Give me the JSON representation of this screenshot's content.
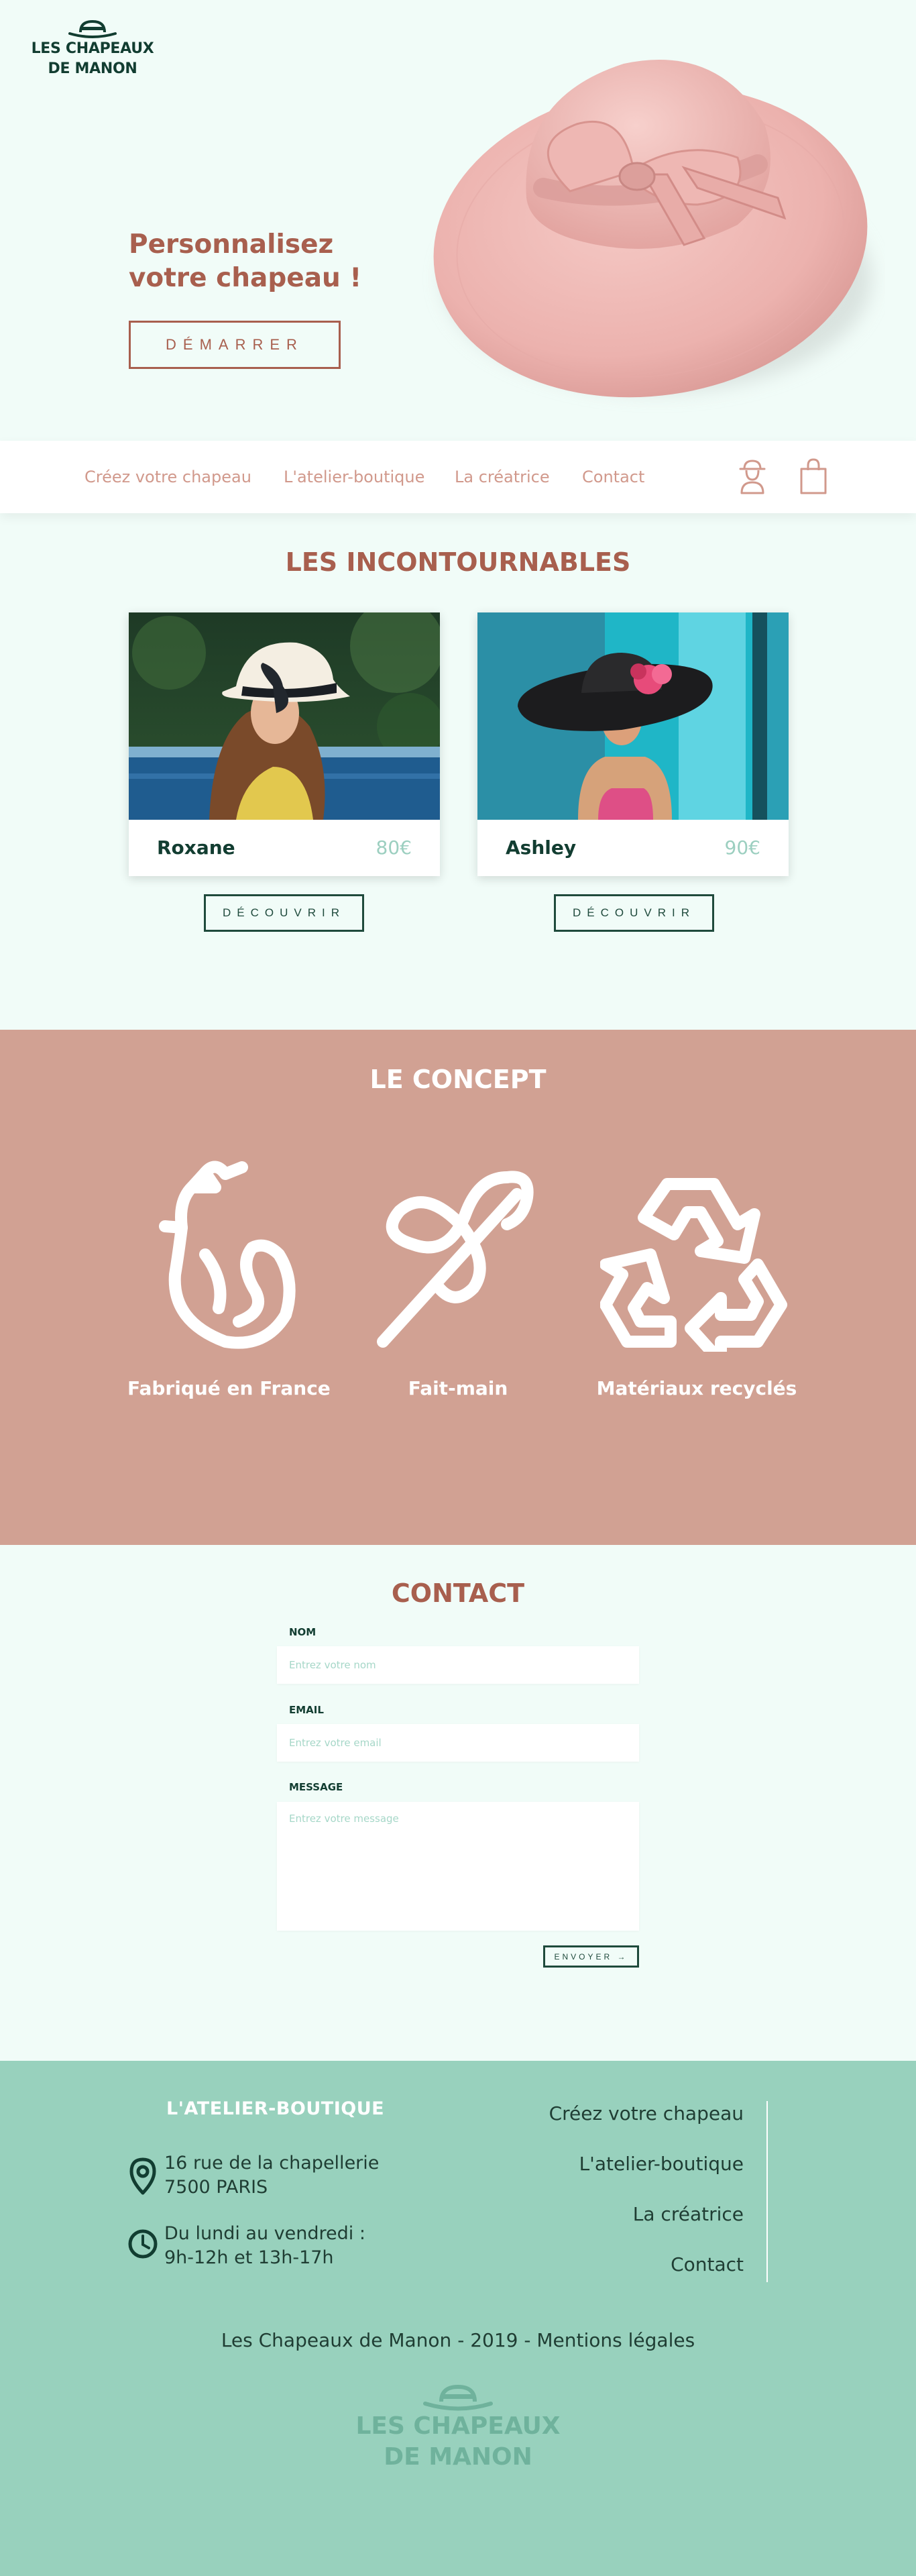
{
  "brand": {
    "line1": "LES CHAPEAUX",
    "line2": "DE MANON"
  },
  "hero": {
    "title": "Personnalisez votre chapeau !",
    "cta": "DÉMARRER"
  },
  "nav": {
    "links": [
      "Créez votre chapeau",
      "L'atelier-boutique",
      "La créatrice",
      "Contact"
    ],
    "icons": [
      "user-icon",
      "shopping-bag-icon"
    ]
  },
  "incontournables": {
    "title": "LES INCONTOURNABLES",
    "products": [
      {
        "name": "Roxane",
        "price": "80€",
        "button": "DÉCOUVRIR"
      },
      {
        "name": "Ashley",
        "price": "90€",
        "button": "DÉCOUVRIR"
      }
    ]
  },
  "concept": {
    "title": "LE CONCEPT",
    "items": [
      {
        "label": "Fabriqué en France",
        "icon": "rooster-icon"
      },
      {
        "label": "Fait-main",
        "icon": "needle-thread-icon"
      },
      {
        "label": "Matériaux recyclés",
        "icon": "recycle-icon"
      }
    ]
  },
  "contact": {
    "title": "CONTACT",
    "name_label": "NOM",
    "name_placeholder": "Entrez votre nom",
    "email_label": "EMAIL",
    "email_placeholder": "Entrez votre email",
    "message_label": "MESSAGE",
    "message_placeholder": "Entrez votre message",
    "send": "ENVOYER →"
  },
  "footer": {
    "heading": "L'ATELIER-BOUTIQUE",
    "address_line1": "16 rue de la chapellerie",
    "address_line2": "7500 PARIS",
    "hours_line1": "Du lundi au vendredi :",
    "hours_line2": "9h-12h et 13h-17h",
    "links": [
      "Créez votre chapeau",
      "L'atelier-boutique",
      "La créatrice",
      "Contact"
    ],
    "legal_prefix": "Les Chapeaux de Manon - 2019 - ",
    "legal_link": "Mentions légales"
  },
  "colors": {
    "background": "#f1fcf8",
    "accent_rust": "#a85f4e",
    "dark_green": "#123d31",
    "concept_bg": "#d1a193",
    "footer_bg": "#98d1bd",
    "price_mint": "#9ccfc0"
  }
}
